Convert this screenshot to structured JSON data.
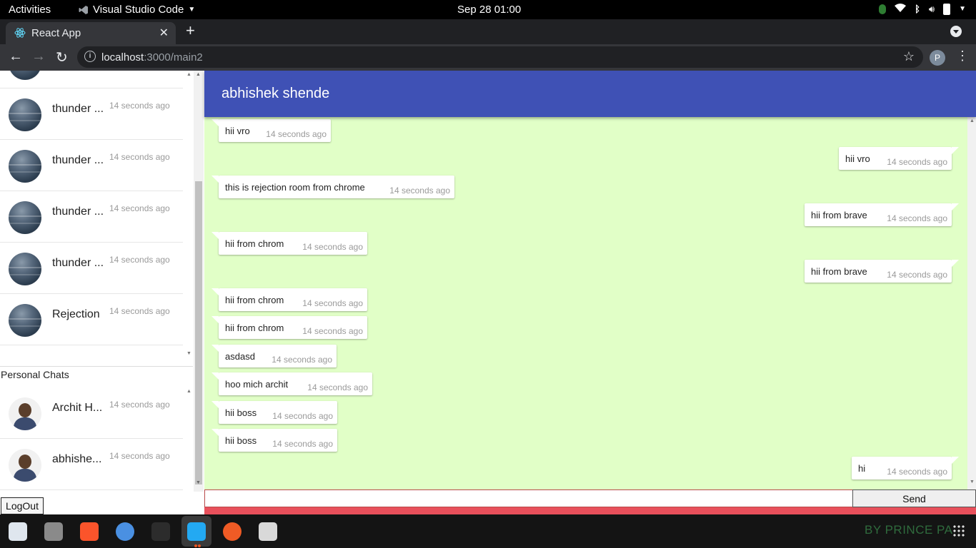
{
  "system_bar": {
    "activities": "Activities",
    "app_name": "Visual Studio Code",
    "clock": "Sep 28  01:00"
  },
  "browser": {
    "tab_title": "React App",
    "url_host": "localhost",
    "url_rest": ":3000/main2",
    "profile_initial": "P"
  },
  "sidebar": {
    "group_chats": [
      {
        "name": "thunder ...",
        "time": "14 seconds ago"
      },
      {
        "name": "thunder ...",
        "time": "14 seconds ago"
      },
      {
        "name": "thunder ...",
        "time": "14 seconds ago"
      },
      {
        "name": "thunder ...",
        "time": "14 seconds ago"
      },
      {
        "name": "thunder ...",
        "time": "14 seconds ago"
      },
      {
        "name": "Rejection",
        "time": "14 seconds ago"
      }
    ],
    "personal_title": "Personal Chats",
    "personal_chats": [
      {
        "name": "Archit H...",
        "time": "14 seconds ago"
      },
      {
        "name": "abhishe...",
        "time": "14 seconds ago"
      }
    ],
    "logout_label": "LogOut"
  },
  "chat": {
    "header_title": "abhishek shende",
    "messages": [
      {
        "text": "hii vro",
        "time": "14 seconds ago",
        "dir": "in"
      },
      {
        "text": "hii vro",
        "time": "14 seconds ago",
        "dir": "out"
      },
      {
        "text": "this is rejection room from chrome",
        "time": "14 seconds ago",
        "dir": "in"
      },
      {
        "text": "hii from brave",
        "time": "14 seconds ago",
        "dir": "out"
      },
      {
        "text": "hii from chrom",
        "time": "14 seconds ago",
        "dir": "in"
      },
      {
        "text": "hii from brave",
        "time": "14 seconds ago",
        "dir": "out"
      },
      {
        "text": "hii from chrom",
        "time": "14 seconds ago",
        "dir": "in"
      },
      {
        "text": "hii from chrom",
        "time": "14 seconds ago",
        "dir": "in"
      },
      {
        "text": "asdasd",
        "time": "14 seconds ago",
        "dir": "in"
      },
      {
        "text": "hoo mich archit",
        "time": "14 seconds ago",
        "dir": "in"
      },
      {
        "text": "hii boss",
        "time": "14 seconds ago",
        "dir": "in"
      },
      {
        "text": "hii boss",
        "time": "14 seconds ago",
        "dir": "in"
      },
      {
        "text": "hi",
        "time": "14 seconds ago",
        "dir": "out"
      }
    ],
    "input_value": "",
    "send_label": "Send"
  },
  "dock": {
    "icons": [
      "text-editor-icon",
      "files-icon",
      "brave-browser-icon",
      "chromium-icon",
      "terminal-icon",
      "vscode-icon",
      "postman-icon",
      "reader-icon"
    ],
    "wallpaper_text": "BY PRINCE PA"
  },
  "colors": {
    "header_bg": "#3f51b5",
    "chat_bg": "#e1ffc7",
    "footer_band": "#e8505b"
  }
}
